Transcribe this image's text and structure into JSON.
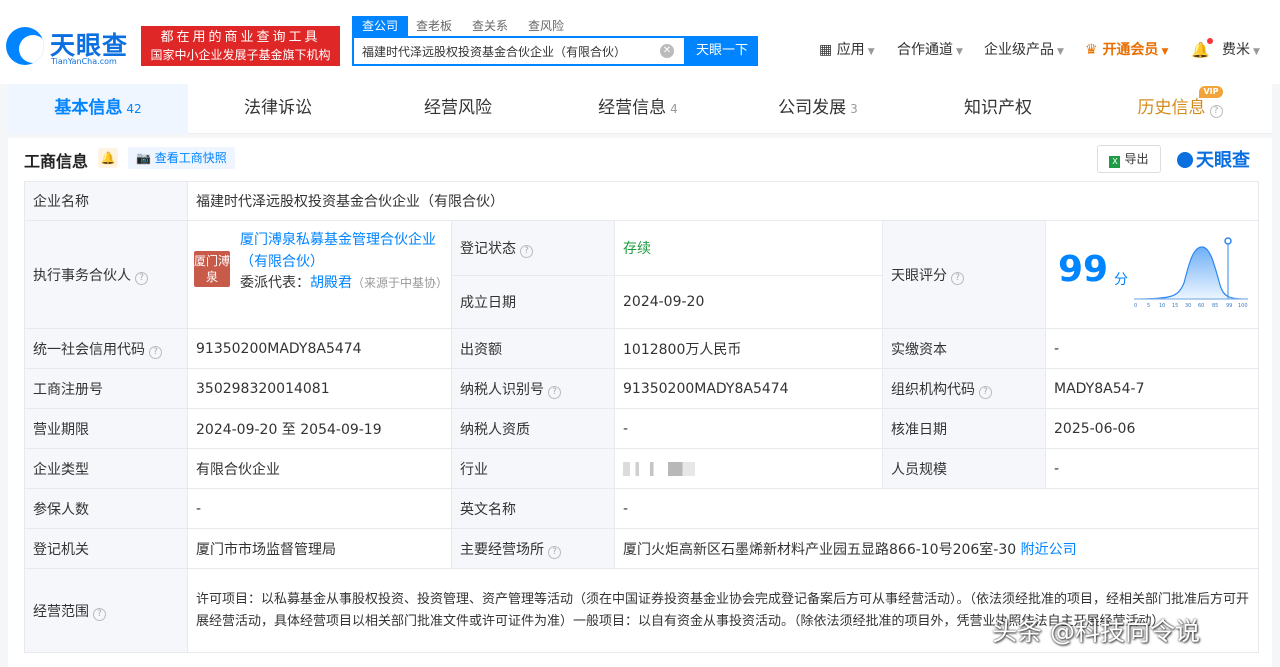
{
  "brand": {
    "name_cn": "天眼查",
    "name_en": "TianYanCha.com",
    "slogan1": "都在用的商业查询工具",
    "slogan2": "国家中小企业发展子基金旗下机构"
  },
  "search": {
    "tabs": [
      "查公司",
      "查老板",
      "查关系",
      "查风险"
    ],
    "value": "福建时代泽远股权投资基金合伙企业（有限合伙）",
    "button": "天眼一下"
  },
  "nav": {
    "apps": "应用",
    "channel": "合作通道",
    "enterprise": "企业级产品",
    "vip": "开通会员",
    "user": "费米"
  },
  "tabs": [
    {
      "label": "基本信息",
      "count": "42"
    },
    {
      "label": "法律诉讼",
      "count": ""
    },
    {
      "label": "经营风险",
      "count": ""
    },
    {
      "label": "经营信息",
      "count": "4"
    },
    {
      "label": "公司发展",
      "count": "3"
    },
    {
      "label": "知识产权",
      "count": ""
    },
    {
      "label": "历史信息",
      "count": ""
    }
  ],
  "vip_tag": "VIP",
  "section": {
    "title": "工商信息",
    "snapshot": "查看工商快照",
    "export": "导出",
    "brand": "天眼查"
  },
  "info": {
    "company_name_label": "企业名称",
    "company_name": "福建时代泽远股权投资基金合伙企业（有限合伙）",
    "partner_label": "执行事务合伙人",
    "partner_logo": "厦门溥泉",
    "partner_name": "厦门溥泉私募基金管理合伙企业（有限合伙）",
    "partner_rep_label": "委派代表：",
    "partner_rep": "胡殿君",
    "partner_rep_source": "（来源于中基协）",
    "status_label": "登记状态",
    "status": "存续",
    "found_label": "成立日期",
    "found": "2024-09-20",
    "score_label": "天眼评分",
    "score": "99",
    "score_unit": "分",
    "credit_label": "统一社会信用代码",
    "credit": "91350200MADY8A5474",
    "capital_label": "出资额",
    "capital": "1012800万人民币",
    "paid_label": "实缴资本",
    "paid": "-",
    "reg_label": "工商注册号",
    "reg": "350298320014081",
    "tax_label": "纳税人识别号",
    "tax": "91350200MADY8A5474",
    "org_label": "组织机构代码",
    "org": "MADY8A54-7",
    "term_label": "营业期限",
    "term": "2024-09-20 至 2054-09-19",
    "taxq_label": "纳税人资质",
    "taxq": "-",
    "approve_label": "核准日期",
    "approve": "2025-06-06",
    "type_label": "企业类型",
    "type": "有限合伙企业",
    "industry_label": "行业",
    "staff_label": "人员规模",
    "staff": "-",
    "insured_label": "参保人数",
    "insured": "-",
    "en_label": "英文名称",
    "en": "-",
    "authority_label": "登记机关",
    "authority": "厦门市市场监督管理局",
    "address_label": "主要经营场所",
    "address": "厦门火炬高新区石墨烯新材料产业园五显路866-10号206室-30",
    "nearby": "附近公司",
    "scope_label": "经营范围",
    "scope": "许可项目：以私募基金从事股权投资、投资管理、资产管理等活动（须在中国证券投资基金业协会完成登记备案后方可从事经营活动）。（依法须经批准的项目，经相关部门批准后方可开展经营活动，具体经营项目以相关部门批准文件或许可证件为准）一般项目：以自有资金从事投资活动。（除依法须经批准的项目外，凭营业执照依法自主开展经营活动）"
  },
  "score_axis": [
    "0",
    "5",
    "10",
    "15",
    "30",
    "60",
    "85",
    "99",
    "100"
  ],
  "watermark": "头条 @科技向令说"
}
